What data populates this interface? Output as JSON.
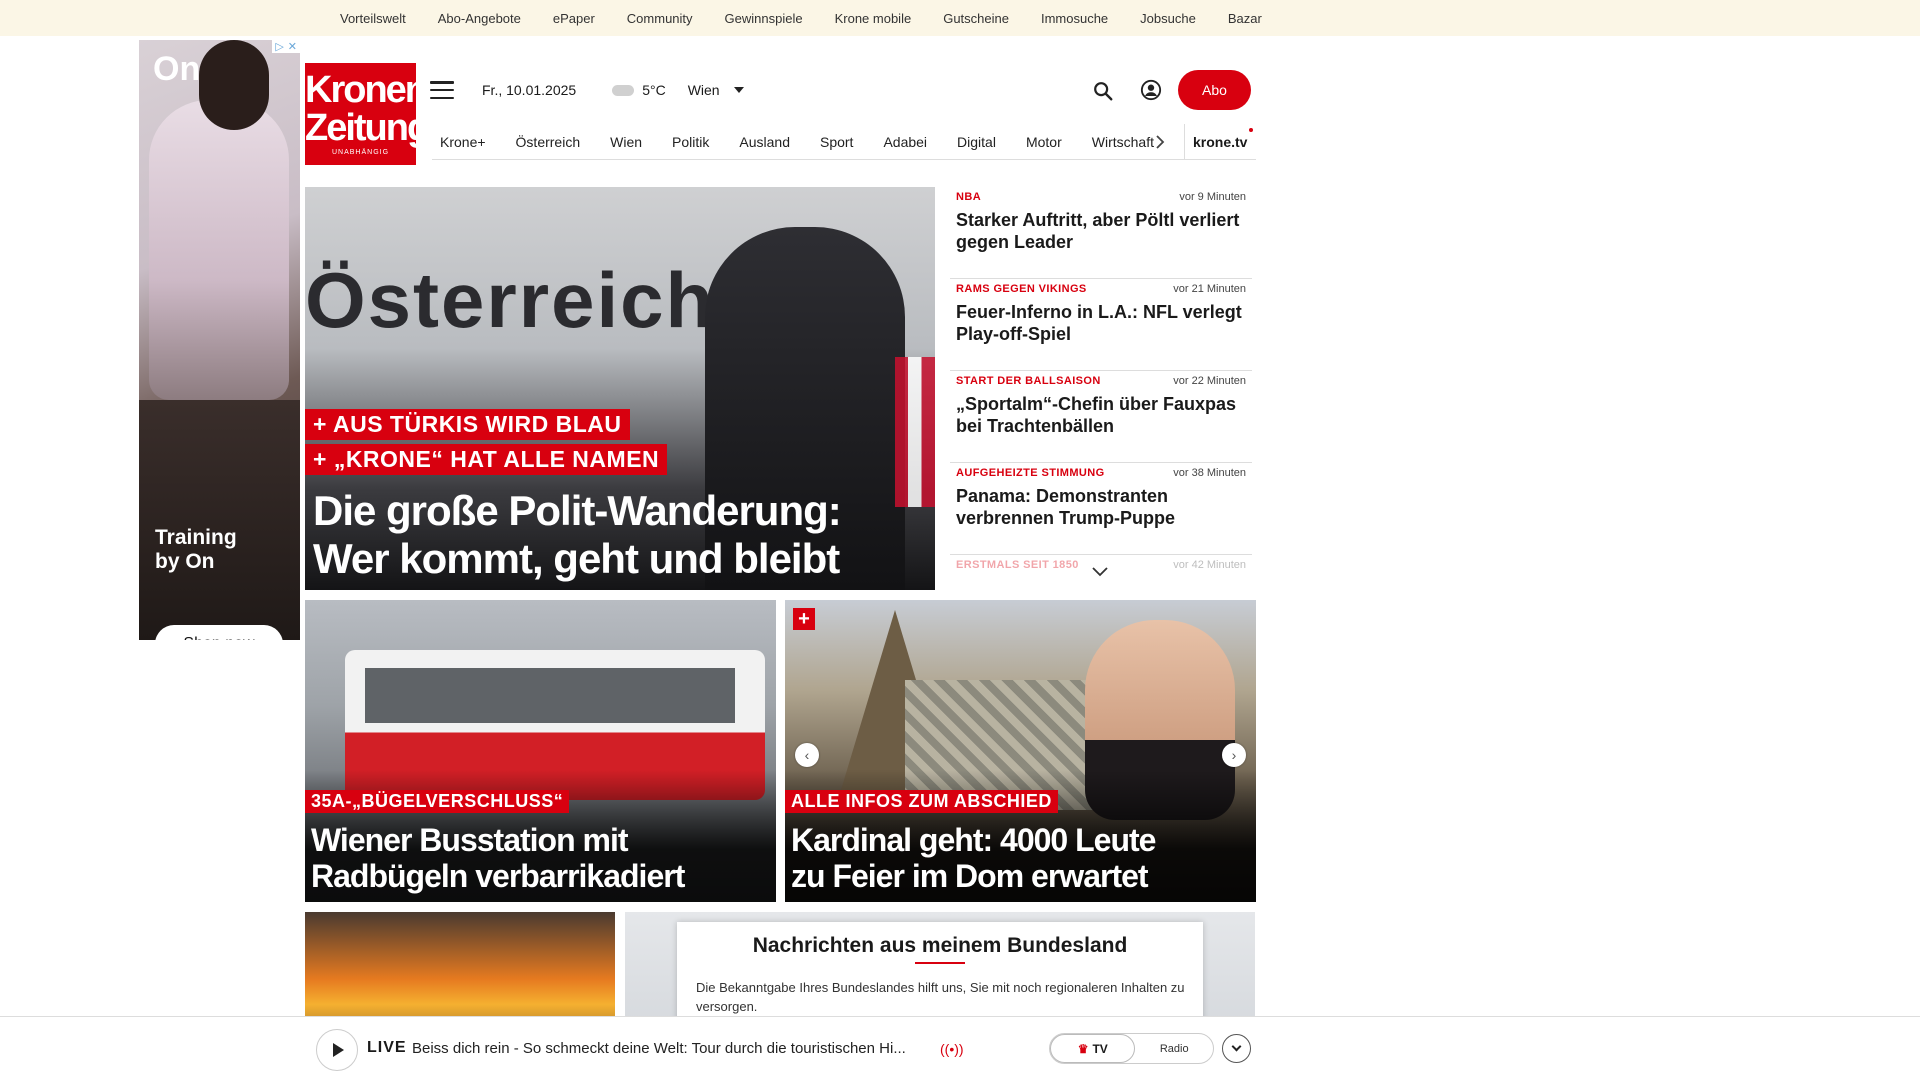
{
  "topbar": {
    "links": [
      "Vorteilswelt",
      "Abo-Angebote",
      "ePaper",
      "Community",
      "Gewinnspiele",
      "Krone mobile",
      "Gutscheine",
      "Immosuche",
      "Jobsuche",
      "Bazar"
    ]
  },
  "ad": {
    "brand": "On",
    "tagline_1": "Training",
    "tagline_2": "by On",
    "cta": "Shop now"
  },
  "logo": {
    "line1": "Kronen",
    "line2": "Zeitung",
    "line3": "UNABHÄNGIG"
  },
  "header": {
    "date": "Fr., 10.01.2025",
    "temperature": "5°C",
    "region": "Wien",
    "abo_label": "Abo"
  },
  "nav": {
    "items": [
      "Krone+",
      "Österreich",
      "Wien",
      "Politik",
      "Ausland",
      "Sport",
      "Adabei",
      "Digital",
      "Motor",
      "Wirtschaft"
    ],
    "tv": "krone.tv"
  },
  "hero": {
    "bg_word": "Österreichp",
    "kicker_1": "+ AUS TÜRKIS WIRD BLAU",
    "kicker_2": "+ „KRONE“ HAT ALLE NAMEN",
    "headline_1": "Die große Polit-Wanderung:",
    "headline_2": "Wer kommt, geht und bleibt"
  },
  "ticker": [
    {
      "category": "NBA",
      "time": "vor 9 Minuten",
      "title": "Starker Auftritt, aber Pöltl verliert gegen Leader"
    },
    {
      "category": "RAMS GEGEN VIKINGS",
      "time": "vor 21 Minuten",
      "title": "Feuer-Inferno in L.A.: NFL verlegt Play-off-Spiel"
    },
    {
      "category": "START DER BALLSAISON",
      "time": "vor 22 Minuten",
      "title": "„Sportalm“-Chefin über Fauxpas bei Trachtenbällen"
    },
    {
      "category": "AUFGEHEIZTE STIMMUNG",
      "time": "vor 38 Minuten",
      "title": "Panama: Demonstranten verbrennen Trump-Puppe"
    },
    {
      "category": "ERSTMALS SEIT 1850",
      "time": "vor 42 Minuten",
      "title": ""
    }
  ],
  "cards": [
    {
      "kicker": "35A-„BÜGELVERSCHLUSS“",
      "headline_1": "Wiener Busstation mit",
      "headline_2": "Radbügeln verbarrikadiert"
    },
    {
      "kicker": "ALLE INFOS ZUM ABSCHIED",
      "headline_1": "Kardinal geht: 4000 Leute",
      "headline_2": "zu Feier im Dom erwartet"
    }
  ],
  "popup": {
    "title": "Nachrichten aus meinem Bundesland",
    "text": "Die Bekanntgabe Ihres Bundeslandes hilft uns, Sie mit noch regionaleren Inhalten zu versorgen."
  },
  "player": {
    "live_label": "LIVE",
    "now_playing": "Beiss dich rein - So schmeckt deine Welt: Tour durch die touristischen Hi...",
    "tv_label": "TV",
    "radio_label": "Radio"
  },
  "colors": {
    "brand_red": "#d8000f",
    "topbar_bg": "#fbf6e6"
  }
}
